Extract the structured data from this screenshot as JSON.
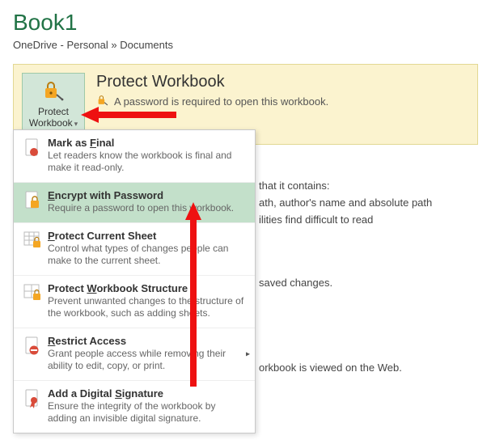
{
  "header": {
    "title": "Book1",
    "breadcrumb": "OneDrive - Personal » Documents"
  },
  "tile": {
    "buttonLine1": "Protect",
    "buttonLine2": "Workbook",
    "title": "Protect Workbook",
    "subtitle": "A password is required to open this workbook."
  },
  "bg": {
    "l1": "that it contains:",
    "l2": "ath, author's name and absolute path",
    "l3": "ilities find difficult to read",
    "l4": "saved changes.",
    "l5": "orkbook is viewed on the Web."
  },
  "menu": [
    {
      "title_pre": "Mark as ",
      "title_u": "F",
      "title_post": "inal",
      "desc": "Let readers know the workbook is final and make it read-only."
    },
    {
      "title_pre": "",
      "title_u": "E",
      "title_post": "ncrypt with Password",
      "desc": "Require a password to open this workbook."
    },
    {
      "title_pre": "",
      "title_u": "P",
      "title_post": "rotect Current Sheet",
      "desc": "Control what types of changes people can make to the current sheet."
    },
    {
      "title_pre": "Protect ",
      "title_u": "W",
      "title_post": "orkbook Structure",
      "desc": "Prevent unwanted changes to the structure of the workbook, such as adding sheets."
    },
    {
      "title_pre": "",
      "title_u": "R",
      "title_post": "estrict Access",
      "desc": "Grant people access while removing their ability to edit, copy, or print."
    },
    {
      "title_pre": "Add a Digital ",
      "title_u": "S",
      "title_post": "ignature",
      "desc": "Ensure the integrity of the workbook by adding an invisible digital signature."
    }
  ],
  "icons": {
    "protect": "lock-key-icon",
    "mark_final": "document-seal-icon",
    "encrypt": "document-lock-icon",
    "sheet": "sheet-lock-icon",
    "structure": "grid-lock-icon",
    "restrict": "no-entry-icon",
    "signature": "ribbon-icon"
  }
}
